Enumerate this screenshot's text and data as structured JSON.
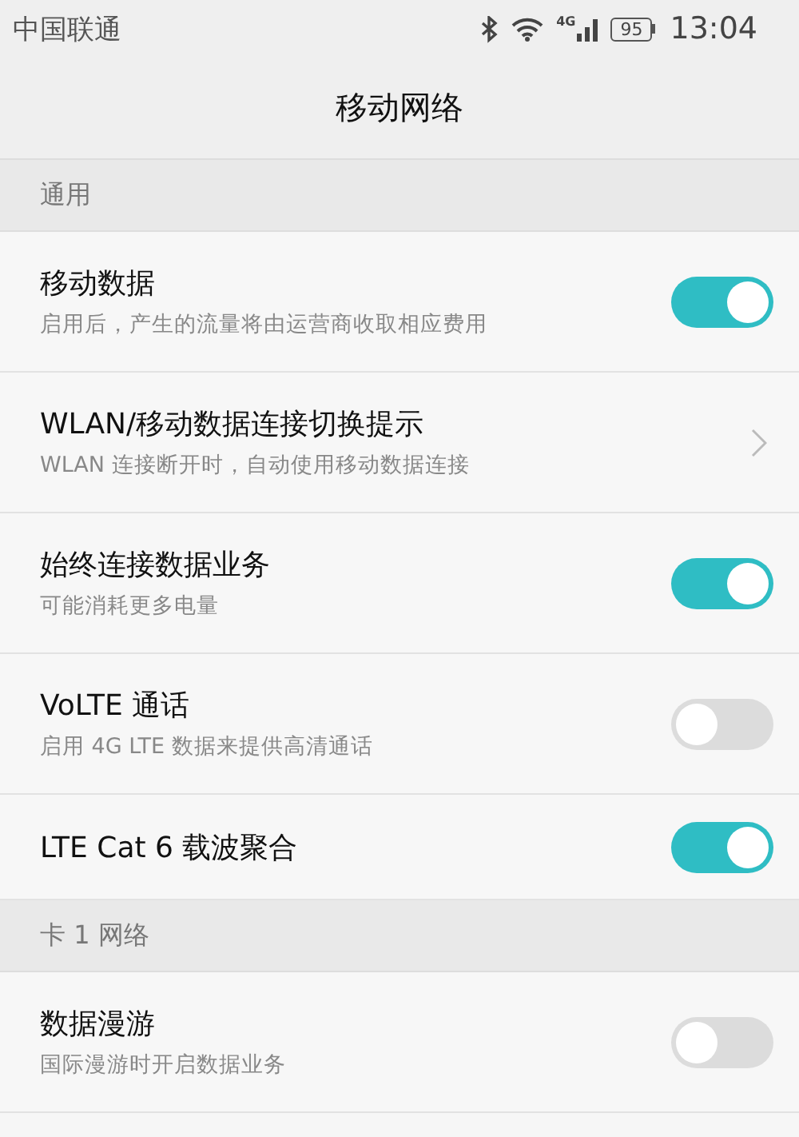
{
  "status_bar": {
    "carrier": "中国联通",
    "network_type": "4G",
    "battery": "95",
    "time": "13:04"
  },
  "title": "移动网络",
  "sections": [
    {
      "header": "通用",
      "items": [
        {
          "kind": "switch",
          "title": "移动数据",
          "subtitle": "启用后，产生的流量将由运营商收取相应费用",
          "on": true
        },
        {
          "kind": "link",
          "title": "WLAN/移动数据连接切换提示",
          "subtitle": "WLAN 连接断开时，自动使用移动数据连接"
        },
        {
          "kind": "switch",
          "title": "始终连接数据业务",
          "subtitle": "可能消耗更多电量",
          "on": true
        },
        {
          "kind": "switch",
          "title": "VoLTE 通话",
          "subtitle": "启用 4G LTE 数据来提供高清通话",
          "on": false
        },
        {
          "kind": "switch",
          "title": "LTE Cat 6 载波聚合",
          "on": true
        }
      ]
    },
    {
      "header": "卡 1 网络",
      "items": [
        {
          "kind": "switch",
          "title": "数据漫游",
          "subtitle": "国际漫游时开启数据业务",
          "on": false
        }
      ]
    }
  ]
}
